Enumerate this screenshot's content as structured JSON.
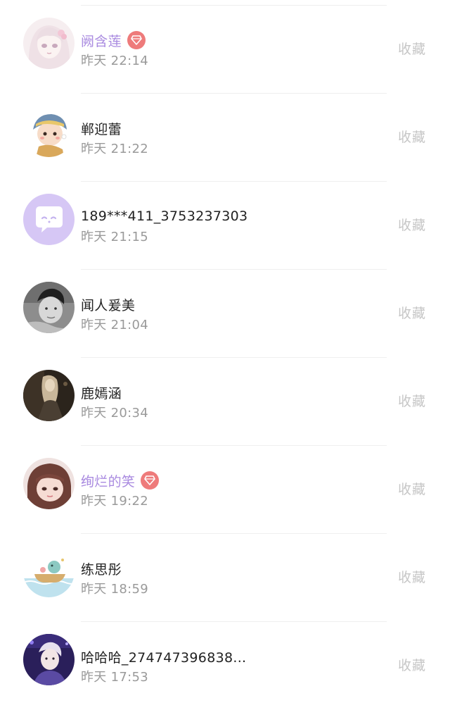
{
  "contacts": [
    {
      "name": "阙含莲",
      "time": "昨天 22:14",
      "vip": true,
      "favorite_label": "收藏",
      "avatar_icon": "anime-girl-avatar-icon"
    },
    {
      "name": "郸迎蕾",
      "time": "昨天 21:22",
      "vip": false,
      "favorite_label": "收藏",
      "avatar_icon": "cartoon-girl-avatar-icon"
    },
    {
      "name": "189***411_3753237303",
      "time": "昨天 21:15",
      "vip": false,
      "favorite_label": "收藏",
      "avatar_icon": "chat-bubble-avatar-icon"
    },
    {
      "name": "闻人爰美",
      "time": "昨天 21:04",
      "vip": false,
      "favorite_label": "收藏",
      "avatar_icon": "man-photo-avatar-icon"
    },
    {
      "name": "鹿嫣涵",
      "time": "昨天 20:34",
      "vip": false,
      "favorite_label": "收藏",
      "avatar_icon": "dark-portrait-avatar-icon"
    },
    {
      "name": "绚烂的笑",
      "time": "昨天 19:22",
      "vip": true,
      "favorite_label": "收藏",
      "avatar_icon": "girl-photo-avatar-icon"
    },
    {
      "name": "练思彤",
      "time": "昨天 18:59",
      "vip": false,
      "favorite_label": "收藏",
      "avatar_icon": "cartoon-boat-avatar-icon"
    },
    {
      "name": "哈哈哈_274747396838...",
      "time": "昨天 17:53",
      "vip": false,
      "favorite_label": "收藏",
      "avatar_icon": "idol-photo-avatar-icon"
    }
  ],
  "colors": {
    "vip_name": "#a98ae0",
    "vip_badge": "#ee7b7b",
    "time_text": "#9a9a9a",
    "favorite_text": "#c6c6c6"
  }
}
